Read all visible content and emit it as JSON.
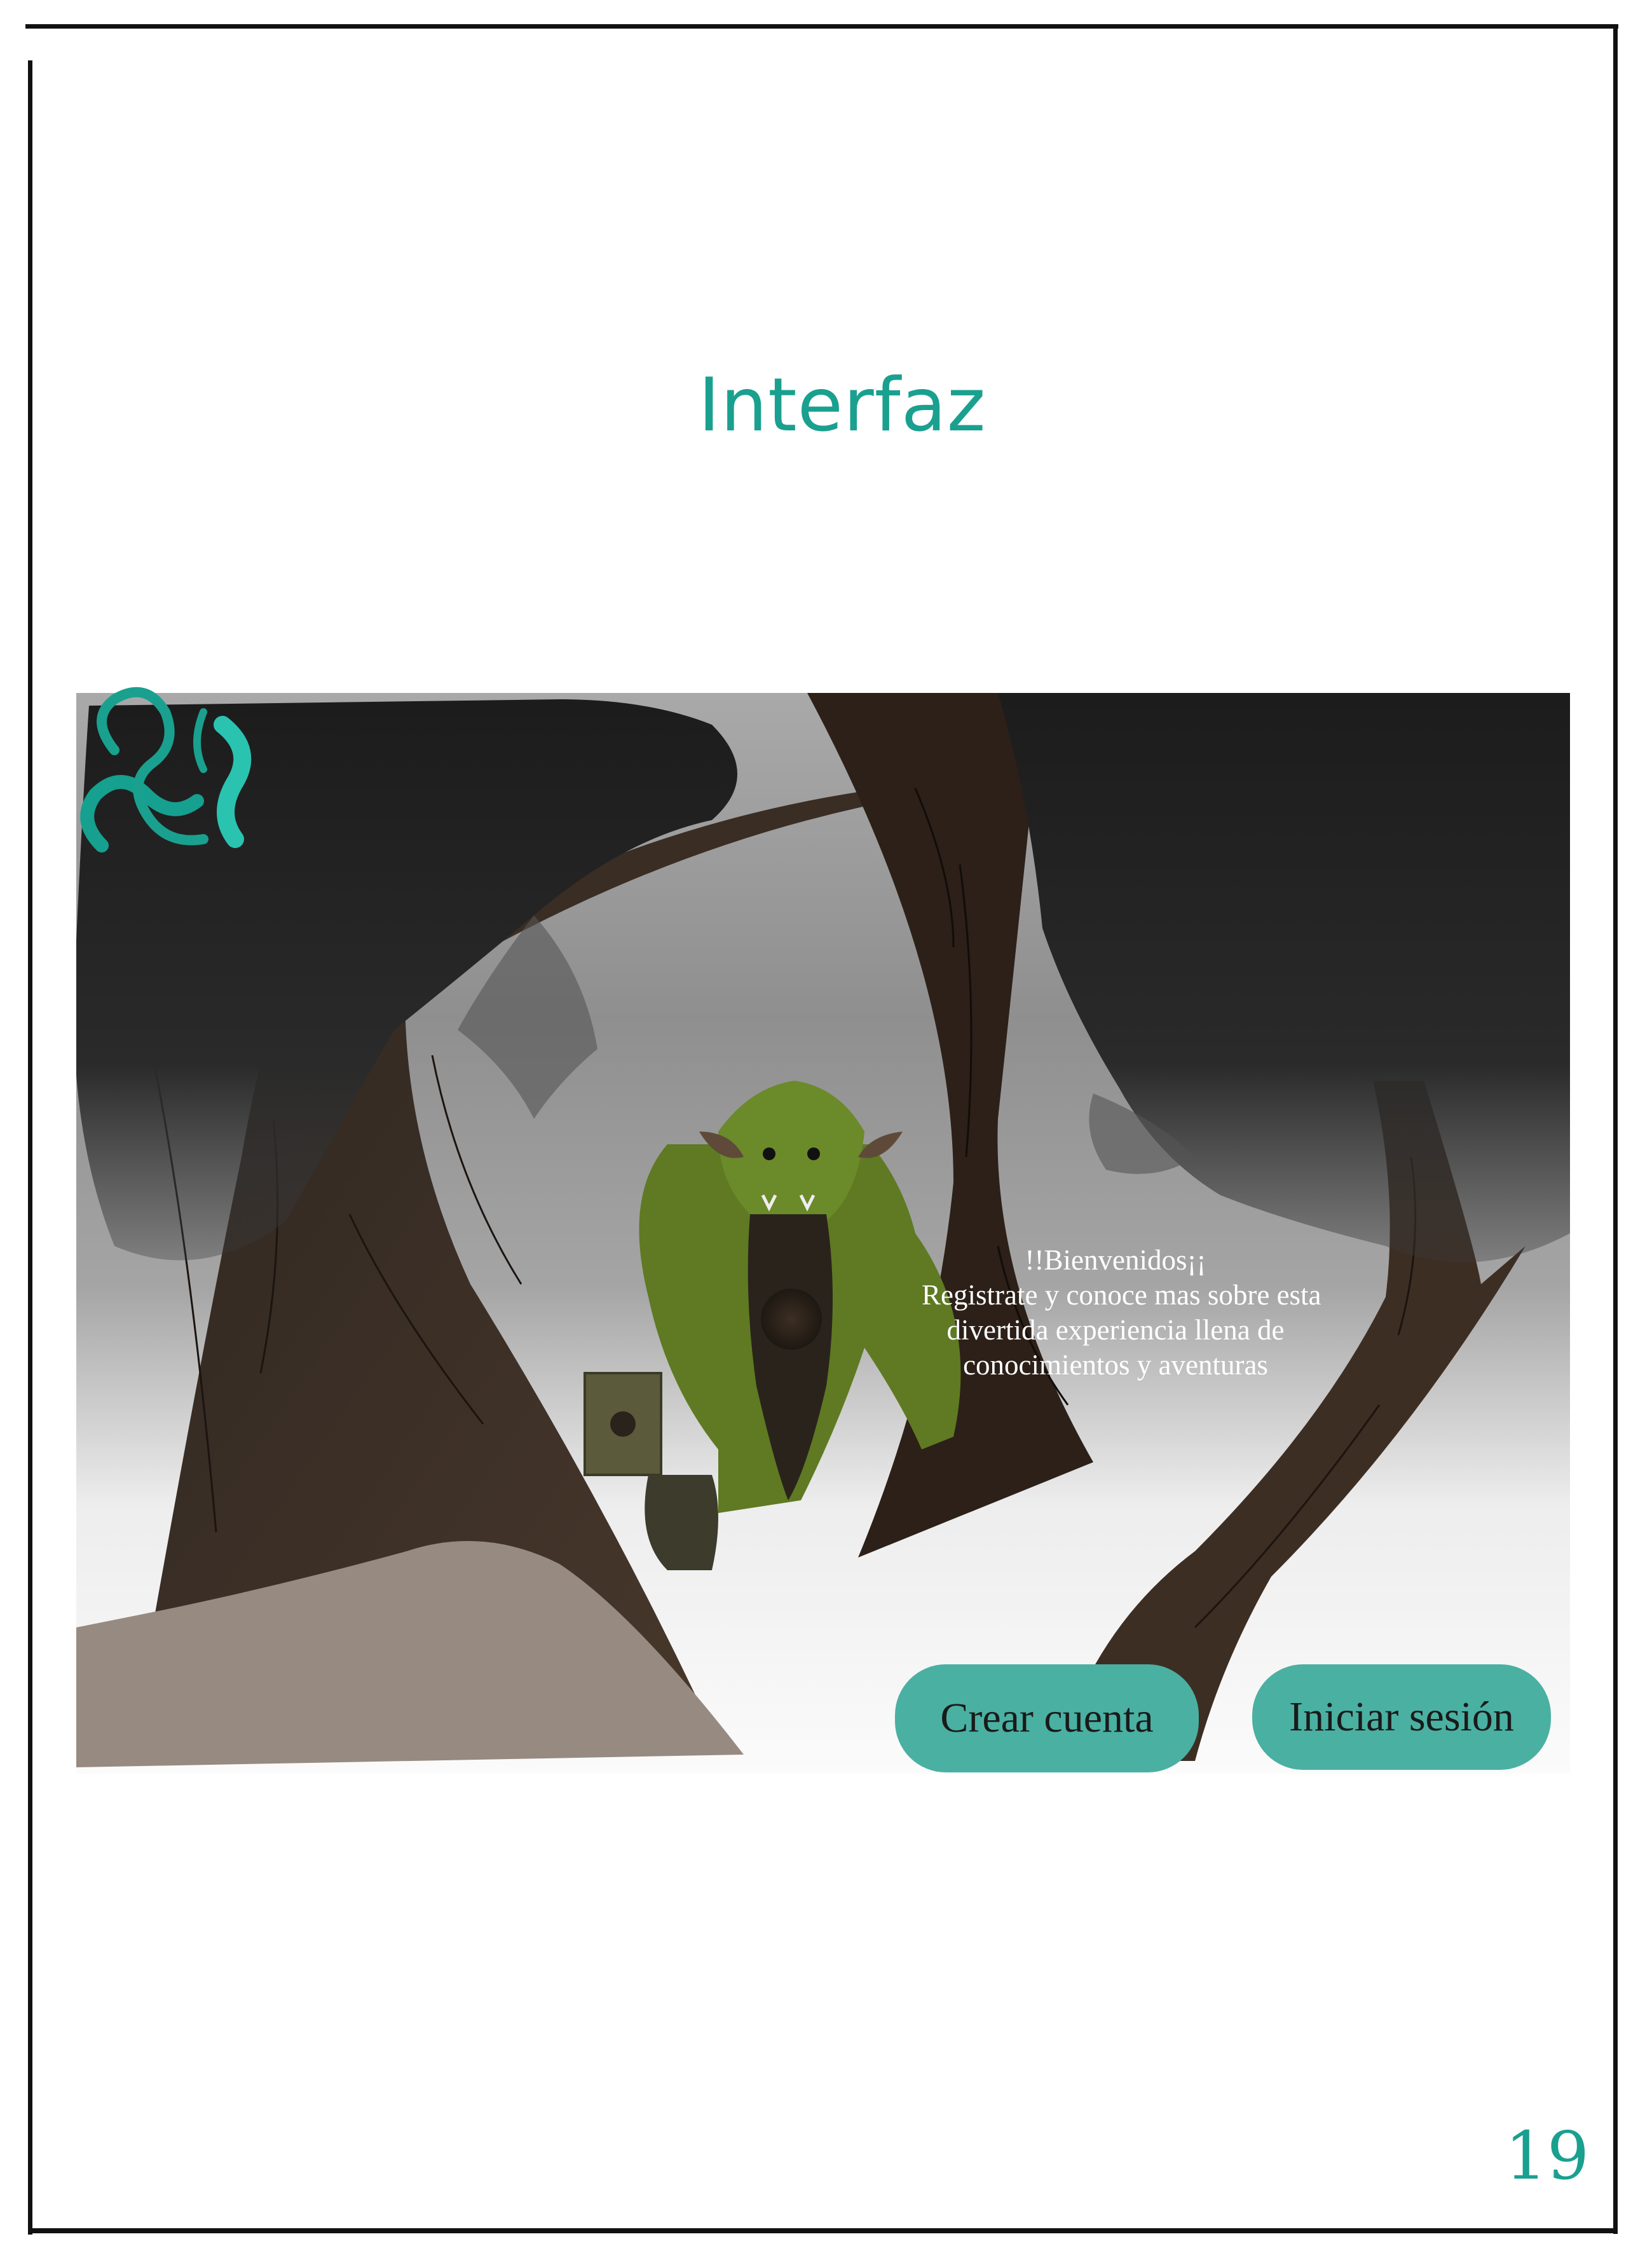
{
  "page": {
    "title": "Interfaz",
    "page_number": "19"
  },
  "scene": {
    "welcome_heading": "!!Bienvenidos¡¡",
    "welcome_lines": [
      "Registrate y conoce mas sobre esta",
      "divertida experiencia llena de",
      "conocimientos y aventuras"
    ],
    "create_account_label": "Crear cuenta",
    "login_label": "Iniciar sesión"
  },
  "colors": {
    "accent": "#1aa08f",
    "button": "#4ab0a2"
  },
  "icons": {
    "logo": "serpent-logo-icon"
  }
}
